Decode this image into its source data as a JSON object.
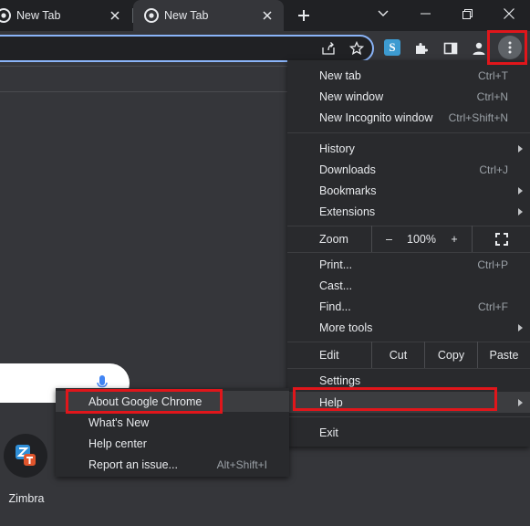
{
  "tabs": [
    {
      "title": "New Tab"
    },
    {
      "title": "New Tab"
    }
  ],
  "shortcuts": [
    {
      "label": "Zimbra"
    }
  ],
  "menu": {
    "items_top": [
      {
        "label": "New tab",
        "shortcut": "Ctrl+T"
      },
      {
        "label": "New window",
        "shortcut": "Ctrl+N"
      },
      {
        "label": "New Incognito window",
        "shortcut": "Ctrl+Shift+N"
      }
    ],
    "items_mid": [
      {
        "label": "History",
        "shortcut": ""
      },
      {
        "label": "Downloads",
        "shortcut": "Ctrl+J"
      },
      {
        "label": "Bookmarks",
        "shortcut": ""
      },
      {
        "label": "Extensions",
        "shortcut": ""
      }
    ],
    "zoom": {
      "label": "Zoom",
      "minus": "–",
      "value": "100%",
      "plus": "+"
    },
    "items_tools": [
      {
        "label": "Print...",
        "shortcut": "Ctrl+P"
      },
      {
        "label": "Cast...",
        "shortcut": ""
      },
      {
        "label": "Find...",
        "shortcut": "Ctrl+F"
      },
      {
        "label": "More tools",
        "shortcut": ""
      }
    ],
    "edit": {
      "label": "Edit",
      "cut": "Cut",
      "copy": "Copy",
      "paste": "Paste"
    },
    "settings": "Settings",
    "help": "Help",
    "exit": "Exit"
  },
  "help_submenu": [
    {
      "label": "About Google Chrome",
      "shortcut": ""
    },
    {
      "label": "What's New",
      "shortcut": ""
    },
    {
      "label": "Help center",
      "shortcut": ""
    },
    {
      "label": "Report an issue...",
      "shortcut": "Alt+Shift+I"
    }
  ],
  "colors": {
    "annotation": "#e0161b",
    "accent": "#8ab4f8",
    "menu_bg": "#292a2d",
    "page_bg": "#35363a"
  }
}
